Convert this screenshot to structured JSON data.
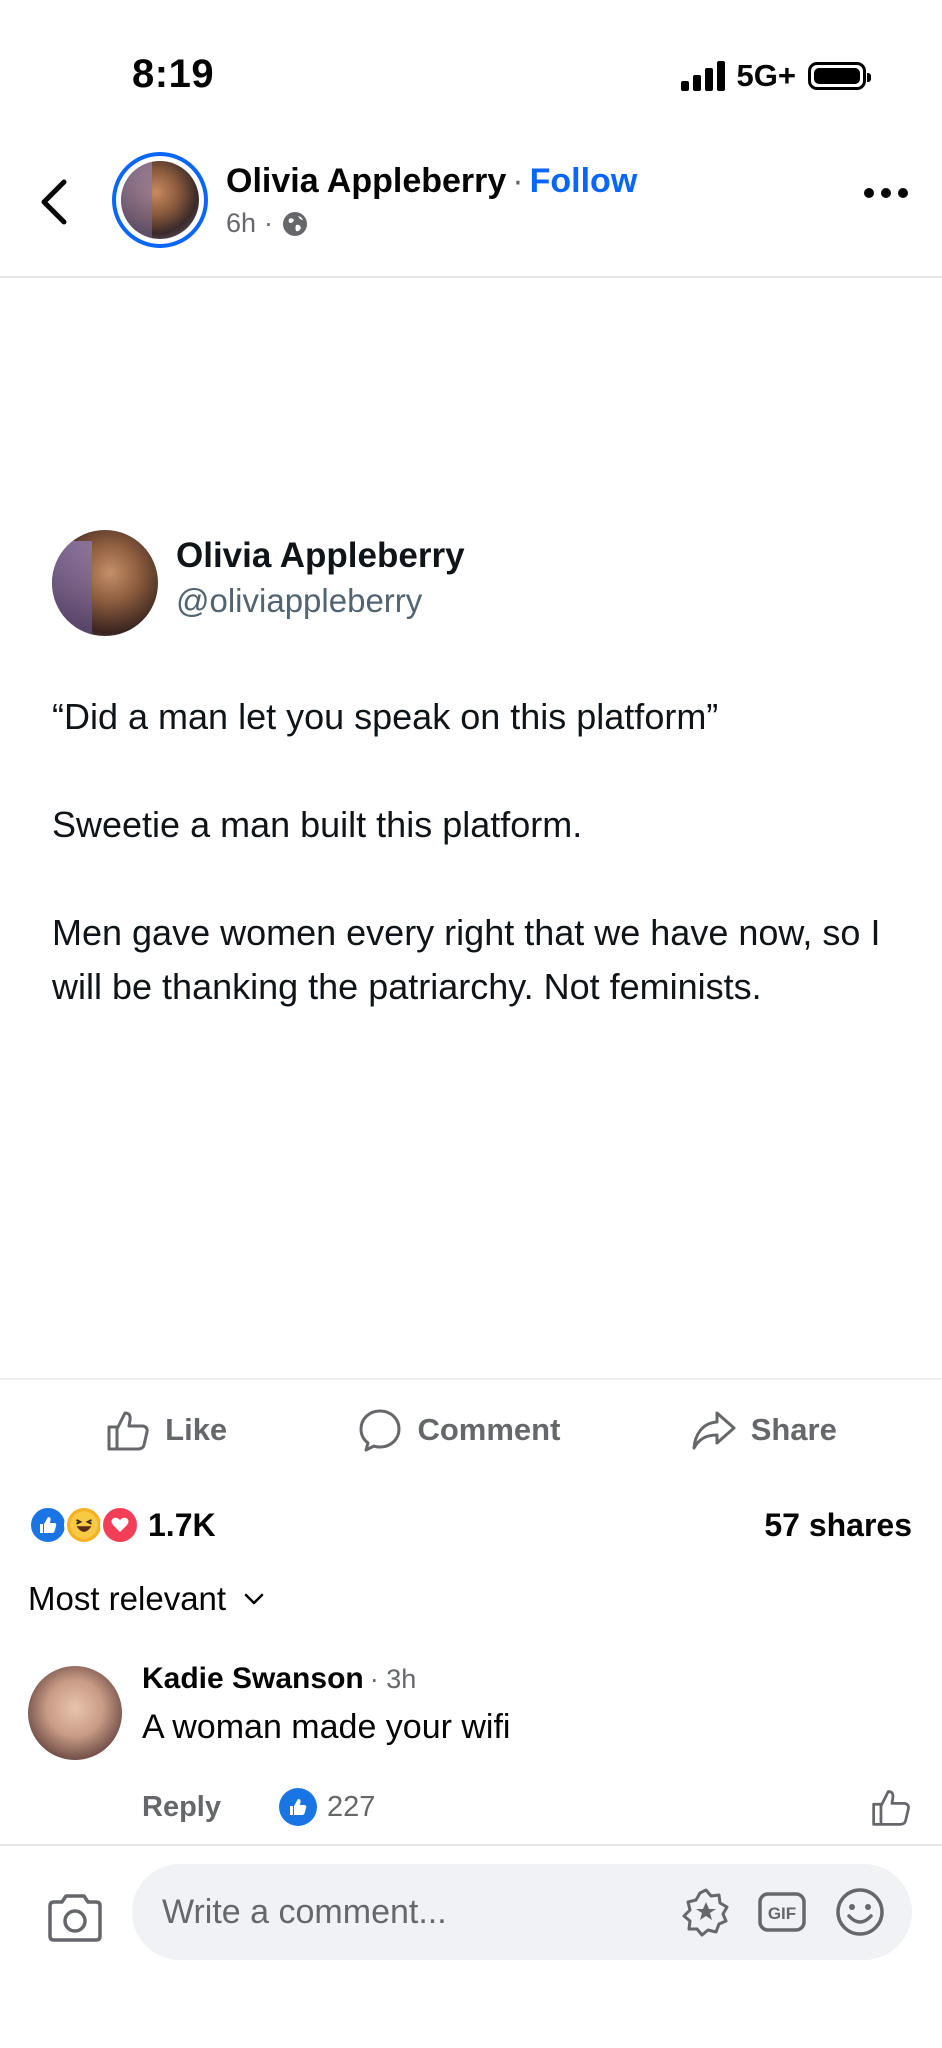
{
  "status_bar": {
    "time": "8:19",
    "network": "5G+"
  },
  "header": {
    "author_name": "Olivia Appleberry",
    "separator": "·",
    "follow_label": "Follow",
    "time_ago": "6h",
    "meta_separator": "·",
    "privacy_icon": "globe-icon"
  },
  "tweet": {
    "name": "Olivia Appleberry",
    "handle": "@oliviappleberry",
    "paragraphs": [
      "“Did a man let you speak on this platform”",
      "Sweetie a man built this platform.",
      "Men gave women every right that we have now, so I will be thanking the patriarchy. Not feminists."
    ]
  },
  "actions": {
    "like_label": "Like",
    "comment_label": "Comment",
    "share_label": "Share"
  },
  "reactions": {
    "types": [
      "like",
      "haha",
      "love"
    ],
    "count": "1.7K",
    "shares": "57 shares"
  },
  "comments_section": {
    "sort_label": "Most relevant",
    "comments": [
      {
        "author": "Kadie Swanson",
        "time": "· 3h",
        "text": "A woman made your wifi",
        "reply_label": "Reply",
        "like_count": "227"
      }
    ]
  },
  "composer": {
    "placeholder": "Write a comment..."
  },
  "colors": {
    "accent": "#0866ff",
    "like_blue": "#1b74e4",
    "secondary_text": "#65676b",
    "input_bg": "#f0f2f5"
  }
}
